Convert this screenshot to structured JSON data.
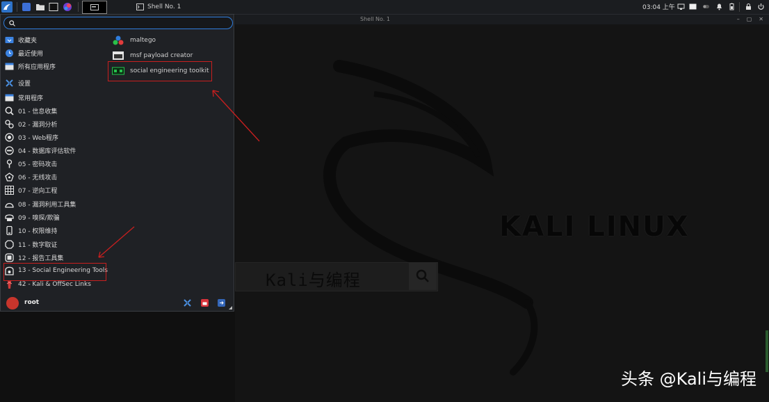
{
  "top_panel": {
    "active_window_title": "Shell No. 1",
    "clock": "03:04 上午"
  },
  "terminal_window": {
    "title": "Shell No. 1"
  },
  "app_menu": {
    "search": {
      "value": "",
      "placeholder": ""
    },
    "categories": [
      {
        "label": "收藏夹",
        "icon": "favorites-icon"
      },
      {
        "label": "最近使用",
        "icon": "recent-icon"
      },
      {
        "label": "所有应用程序",
        "icon": "all-apps-icon"
      },
      {
        "label": "设置",
        "icon": "settings-icon"
      },
      {
        "label": "常用程序",
        "icon": "usual-apps-icon"
      },
      {
        "label": "01 - 信息收集",
        "icon": "info-gathering-icon"
      },
      {
        "label": "02 - 漏洞分析",
        "icon": "vuln-analysis-icon"
      },
      {
        "label": "03 - Web程序",
        "icon": "web-apps-icon"
      },
      {
        "label": "04 - 数据库评估软件",
        "icon": "database-icon"
      },
      {
        "label": "05 - 密码攻击",
        "icon": "password-icon"
      },
      {
        "label": "06 - 无线攻击",
        "icon": "wireless-icon"
      },
      {
        "label": "07 - 逆向工程",
        "icon": "reverse-engineering-icon"
      },
      {
        "label": "08 - 漏洞利用工具集",
        "icon": "exploitation-icon"
      },
      {
        "label": "09 - 嗅探/欺骗",
        "icon": "sniffing-icon"
      },
      {
        "label": "10 - 权限维持",
        "icon": "post-exploitation-icon"
      },
      {
        "label": "11 - 数字取证",
        "icon": "forensics-icon"
      },
      {
        "label": "12 - 报告工具集",
        "icon": "reporting-icon"
      },
      {
        "label": "13 - Social Engineering Tools",
        "icon": "social-engineering-icon"
      },
      {
        "label": "42 - Kali & OffSec Links",
        "icon": "kali-links-icon"
      }
    ],
    "apps": [
      {
        "label": "maltego",
        "icon": "maltego-icon"
      },
      {
        "label": "msf payload creator",
        "icon": "msfpc-icon"
      },
      {
        "label": "social engineering toolkit",
        "icon": "setoolkit-icon"
      }
    ],
    "footer": {
      "user": "root"
    }
  },
  "desktop": {
    "wallpaper_logo": "KALI LINUX",
    "search_text": "Kali与编程"
  },
  "watermark": "头条 @Kali与编程",
  "colors": {
    "menu_bg": "#1f2125",
    "accent": "#2f7ddc",
    "annotation": "#c91f1f"
  }
}
